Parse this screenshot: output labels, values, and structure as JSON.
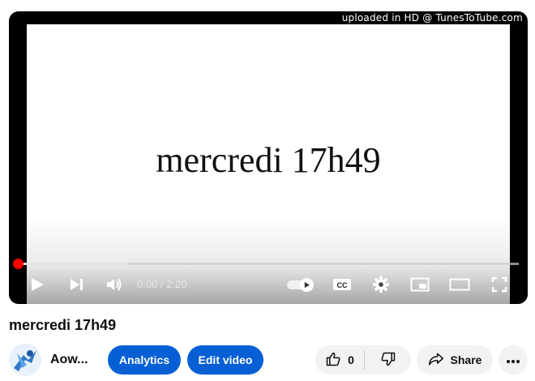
{
  "video": {
    "watermark": "uploaded in HD @ TunesToTube.com",
    "slide_text": "mercredi 17h49",
    "current_time": "0:00",
    "duration": "2:20",
    "time_display": "0:00 / 2:20",
    "played_fraction": 0.0,
    "buffered_fraction": 0.22,
    "controls": {
      "play": "play-icon",
      "next": "next-icon",
      "volume": "volume-icon",
      "autoplay": "autoplay-toggle",
      "captions": "CC",
      "settings": "gear-icon",
      "miniplayer": "miniplayer-icon",
      "theater": "theater-icon",
      "fullscreen": "fullscreen-icon"
    }
  },
  "meta": {
    "title": "mercredi 17h49",
    "channel_name": "Aow...",
    "analytics_label": "Analytics",
    "edit_label": "Edit video",
    "like_count": "0",
    "share_label": "Share",
    "accent_color": "#065fd4",
    "progress_color": "#ff0000"
  }
}
